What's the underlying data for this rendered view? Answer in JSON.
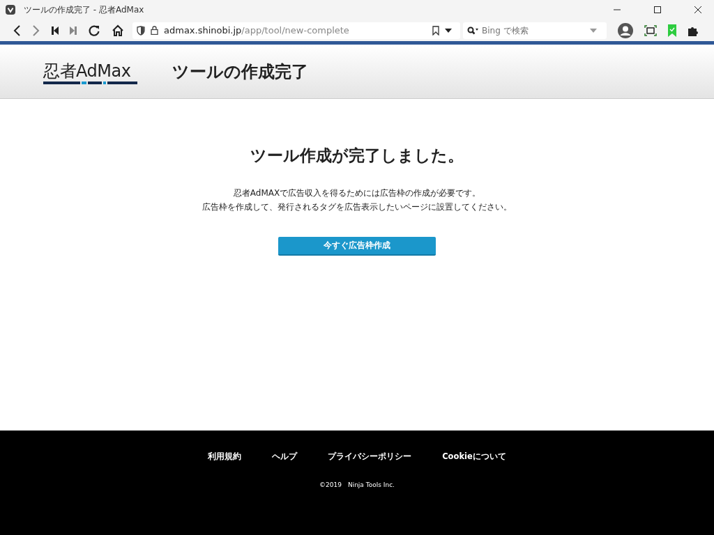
{
  "window": {
    "title": "ツールの作成完了 - 忍者AdMax"
  },
  "address_bar": {
    "host": "admax.shinobi.jp",
    "path": "/app/tool/new-complete"
  },
  "search": {
    "placeholder": "Bing で検索"
  },
  "header": {
    "logo": "忍者AdMax",
    "title": "ツールの作成完了"
  },
  "main": {
    "heading": "ツール作成が完了しました。",
    "lines": [
      "忍者AdMAXで広告収入を得るためには広告枠の作成が必要です。",
      "広告枠を作成して、発行されるタグを広告表示したいページに設置してください。"
    ],
    "button": "今すぐ広告枠作成"
  },
  "footer": {
    "links": [
      "利用規約",
      "ヘルプ",
      "プライバシーポリシー",
      "Cookieについて"
    ],
    "copyright": "©2019　Ninja Tools Inc."
  }
}
